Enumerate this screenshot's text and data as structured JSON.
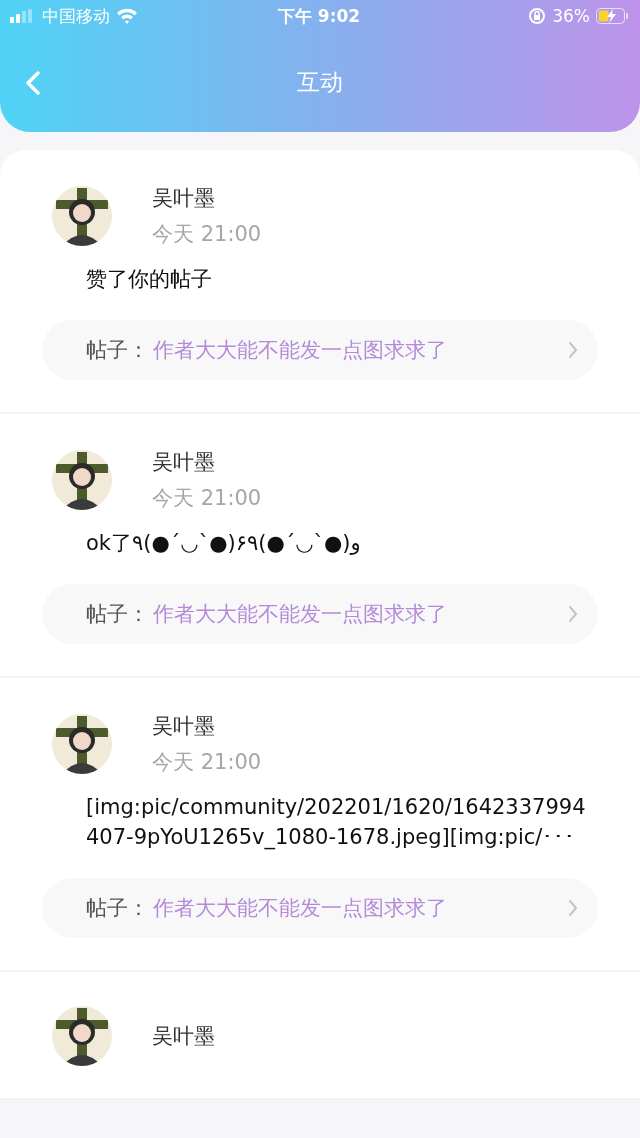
{
  "status_bar": {
    "carrier": "中国移动",
    "time": "下午 9:02",
    "battery": "36%"
  },
  "nav": {
    "title": "互动"
  },
  "notifications": [
    {
      "user": "吴叶墨",
      "time": "今天 21:00",
      "content": "赞了你的帖子",
      "post_label": "帖子：",
      "post_title": "作者大大能不能发一点图求求了"
    },
    {
      "user": "吴叶墨",
      "time": "今天 21:00",
      "content": "ok了٩(●´◡`●)۶٩(●´◡`●)و",
      "post_label": "帖子：",
      "post_title": "作者大大能不能发一点图求求了"
    },
    {
      "user": "吴叶墨",
      "time": "今天 21:00",
      "content": "[img:pic/community/202201/1620/1642337994407-9pYoU1265v_1080-1678.jpeg][img:pic/･･･",
      "post_label": "帖子：",
      "post_title": "作者大大能不能发一点图求求了"
    },
    {
      "user": "吴叶墨"
    }
  ]
}
